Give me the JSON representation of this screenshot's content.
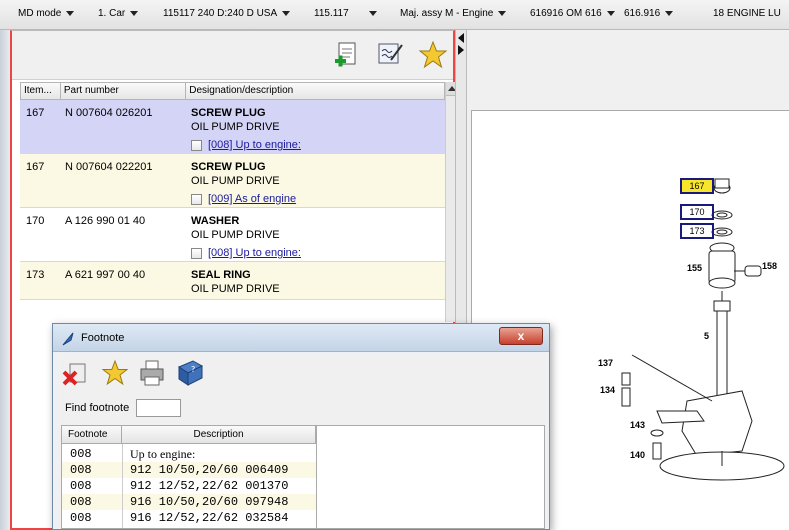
{
  "topbar": {
    "items": [
      {
        "label": "MD mode"
      },
      {
        "label": "1. Car"
      },
      {
        "label": "115117 240 D:240 D USA"
      },
      {
        "label": "115.117"
      },
      {
        "label": "Maj. assy M  - Engine"
      },
      {
        "label": "616916 OM 616"
      },
      {
        "label": "616.916"
      },
      {
        "label": "18 ENGINE LU"
      }
    ]
  },
  "parts_table": {
    "headers": [
      "Item...",
      "Part number",
      "Designation/description"
    ],
    "rows": [
      {
        "item": "167",
        "part_number": "N 007604 026201",
        "name": "SCREW PLUG",
        "desc": "OIL PUMP DRIVE",
        "footnote": "[008] Up to engine:",
        "bg": "#d4d4f7"
      },
      {
        "item": "167",
        "part_number": "N 007604 022201",
        "name": "SCREW PLUG",
        "desc": "OIL PUMP DRIVE",
        "footnote": "[009] As of engine",
        "bg": "#fbf9e4"
      },
      {
        "item": "170",
        "part_number": "A 126 990 01 40",
        "name": "WASHER",
        "desc": "OIL PUMP DRIVE",
        "footnote": "[008] Up to engine:",
        "bg": "#ffffff"
      },
      {
        "item": "173",
        "part_number": "A 621 997 00 40",
        "name": "SEAL RING",
        "desc": "OIL PUMP DRIVE",
        "footnote": "",
        "bg": "#fbf9e4"
      }
    ]
  },
  "drawing": {
    "callouts": [
      "167",
      "170",
      "173"
    ],
    "labels": [
      "155",
      "158",
      "5",
      "137",
      "134",
      "143",
      "140"
    ],
    "highlight_color": "#f7e62a"
  },
  "dialog": {
    "title": "Footnote",
    "close_label": "x",
    "find_label": "Find footnote",
    "find_value": "",
    "headers": [
      "Footnote",
      "Description"
    ],
    "rows": [
      {
        "footnote": "008",
        "description": "Up to engine:"
      },
      {
        "footnote": "008",
        "description": "912 10/50,20/60 006409"
      },
      {
        "footnote": "008",
        "description": "912 12/52,22/62 001370"
      },
      {
        "footnote": "008",
        "description": "916 10/50,20/60 097948"
      },
      {
        "footnote": "008",
        "description": "916 12/52,22/62 032584"
      }
    ]
  }
}
